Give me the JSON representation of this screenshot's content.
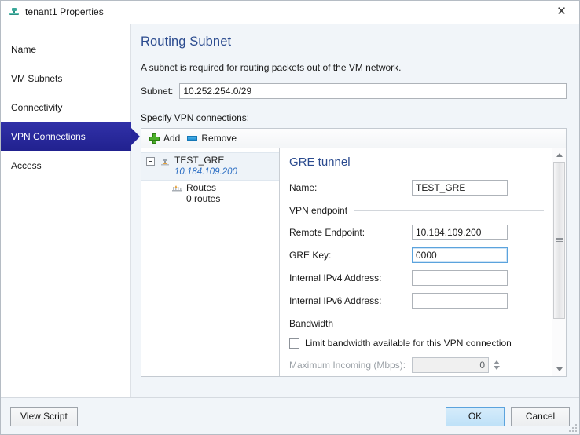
{
  "window": {
    "title": "tenant1 Properties",
    "icon": "network-icon",
    "close_label": "✕"
  },
  "sidebar": {
    "items": [
      {
        "label": "Name",
        "selected": false
      },
      {
        "label": "VM Subnets",
        "selected": false
      },
      {
        "label": "Connectivity",
        "selected": false
      },
      {
        "label": "VPN Connections",
        "selected": true
      },
      {
        "label": "Access",
        "selected": false
      }
    ]
  },
  "main": {
    "page_title": "Routing Subnet",
    "description": "A subnet is required for routing packets out of the VM network.",
    "subnet_label": "Subnet:",
    "subnet_value": "10.252.254.0/29",
    "specify_label": "Specify VPN connections:"
  },
  "toolbar": {
    "add_label": "Add",
    "remove_label": "Remove"
  },
  "tree": {
    "nodes": [
      {
        "title": "TEST_GRE",
        "subtitle": "10.184.109.200",
        "selected": true
      },
      {
        "title": "Routes",
        "subtitle": "0 routes",
        "selected": false
      }
    ]
  },
  "detail": {
    "title": "GRE tunnel",
    "name_label": "Name:",
    "name_value": "TEST_GRE",
    "vpn_endpoint_group": "VPN endpoint",
    "remote_endpoint_label": "Remote Endpoint:",
    "remote_endpoint_value": "10.184.109.200",
    "gre_key_label": "GRE Key:",
    "gre_key_value": "0000",
    "ipv4_label": "Internal IPv4 Address:",
    "ipv4_value": "",
    "ipv6_label": "Internal IPv6 Address:",
    "ipv6_value": "",
    "bandwidth_group": "Bandwidth",
    "limit_checkbox_label": "Limit bandwidth available for this VPN connection",
    "max_incoming_label": "Maximum Incoming (Mbps):",
    "max_incoming_value": "0"
  },
  "footer": {
    "view_script_label": "View Script",
    "ok_label": "OK",
    "cancel_label": "Cancel"
  },
  "colors": {
    "accent_heading": "#2b4b8f",
    "selected_nav": "#26269a",
    "link_blue": "#2d6fc4",
    "primary_button": "#bfe1f8"
  }
}
